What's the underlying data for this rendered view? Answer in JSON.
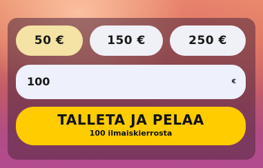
{
  "amount_options": [
    {
      "label": "50 €",
      "selected": true
    },
    {
      "label": "150 €",
      "selected": false
    },
    {
      "label": "250 €",
      "selected": false
    }
  ],
  "deposit_input": {
    "value": "100",
    "currency": "€"
  },
  "cta": {
    "title": "TALLETA JA PELAA",
    "subtitle": "100 ilmaiskierrosta"
  },
  "colors": {
    "selected_option": "#f4e3a4",
    "option": "#f0f0f7",
    "cta": "#ffcc00",
    "input_bg": "#eef0fb"
  }
}
